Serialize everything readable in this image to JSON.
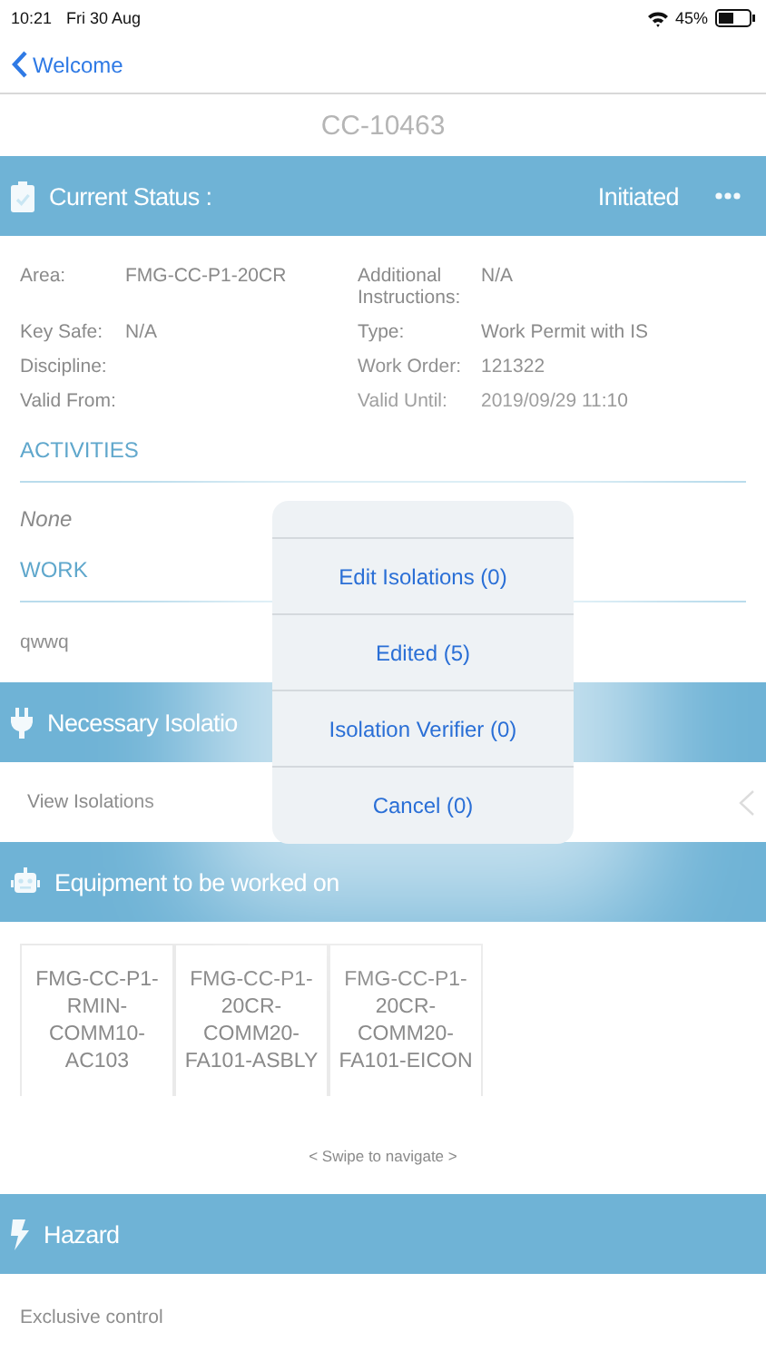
{
  "status_bar": {
    "time": "10:21",
    "date": "Fri 30 Aug",
    "battery": "45%"
  },
  "nav": {
    "back": "Welcome"
  },
  "title": "CC-10463",
  "current_status": {
    "label": "Current Status :",
    "value": "Initiated"
  },
  "details": [
    {
      "label": "Area:",
      "value": "FMG-CC-P1-20CR",
      "label2": "Additional Instructions:",
      "value2": "N/A"
    },
    {
      "label": "Key Safe:",
      "value": "N/A",
      "label2": "Type:",
      "value2": "Work Permit with IS"
    },
    {
      "label": "Discipline:",
      "label2": "Work Order:",
      "value2": "121322"
    },
    {
      "label": "Valid From:",
      "label2": "Valid Until:",
      "value2": "2019/09/29 11:10"
    }
  ],
  "activities": {
    "heading": "ACTIVITIES",
    "text": "None"
  },
  "work": {
    "heading": "WORK",
    "text": "qwwq"
  },
  "isolations": {
    "heading": "Necessary Isolatio",
    "row": "View Isolations"
  },
  "equipment": {
    "heading": "Equipment to be worked on",
    "cards": [
      "FMG-CC-P1-RMIN-COMM10-AC103",
      "FMG-CC-P1-20CR-COMM20-FA101-ASBLY",
      "FMG-CC-P1-20CR-COMM20-FA101-EICON"
    ],
    "hint": "< Swipe to navigate >"
  },
  "hazard": {
    "heading": "Hazard",
    "text": "Exclusive control"
  },
  "action_menu": [
    "Edit Isolations (0)",
    "Edited (5)",
    "Isolation Verifier (0)",
    "Cancel (0)"
  ]
}
